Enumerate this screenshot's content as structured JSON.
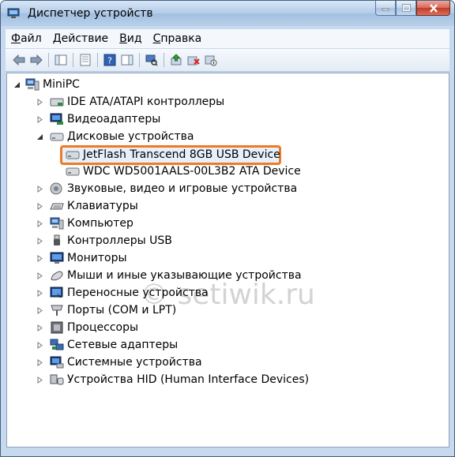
{
  "window": {
    "title": "Диспетчер устройств"
  },
  "menu": [
    {
      "label": "Файл",
      "key": "Ф",
      "rest": "айл"
    },
    {
      "label": "Действие",
      "key": "Д",
      "rest": "ействие"
    },
    {
      "label": "Вид",
      "key": "В",
      "rest": "ид"
    },
    {
      "label": "Справка",
      "key": "С",
      "rest": "правка"
    }
  ],
  "tree": {
    "root": "MiniPC",
    "items": [
      {
        "label": "IDE ATA/ATAPI контроллеры"
      },
      {
        "label": "Видеоадаптеры"
      },
      {
        "label": "Дисковые устройства",
        "expanded": true,
        "children": [
          "JetFlash Transcend 8GB USB Device",
          "WDC WD5001AALS-00L3B2 ATA Device"
        ]
      },
      {
        "label": "Звуковые, видео и игровые устройства"
      },
      {
        "label": "Клавиатуры"
      },
      {
        "label": "Компьютер"
      },
      {
        "label": "Контроллеры USB"
      },
      {
        "label": "Мониторы"
      },
      {
        "label": "Мыши и иные указывающие устройства"
      },
      {
        "label": "Переносные устройства"
      },
      {
        "label": "Порты (COM и LPT)"
      },
      {
        "label": "Процессоры"
      },
      {
        "label": "Сетевые адаптеры"
      },
      {
        "label": "Системные устройства"
      },
      {
        "label": "Устройства HID (Human Interface Devices)"
      }
    ]
  },
  "watermark": "© setiwik.ru",
  "colors": {
    "highlight": "#f07a24"
  }
}
